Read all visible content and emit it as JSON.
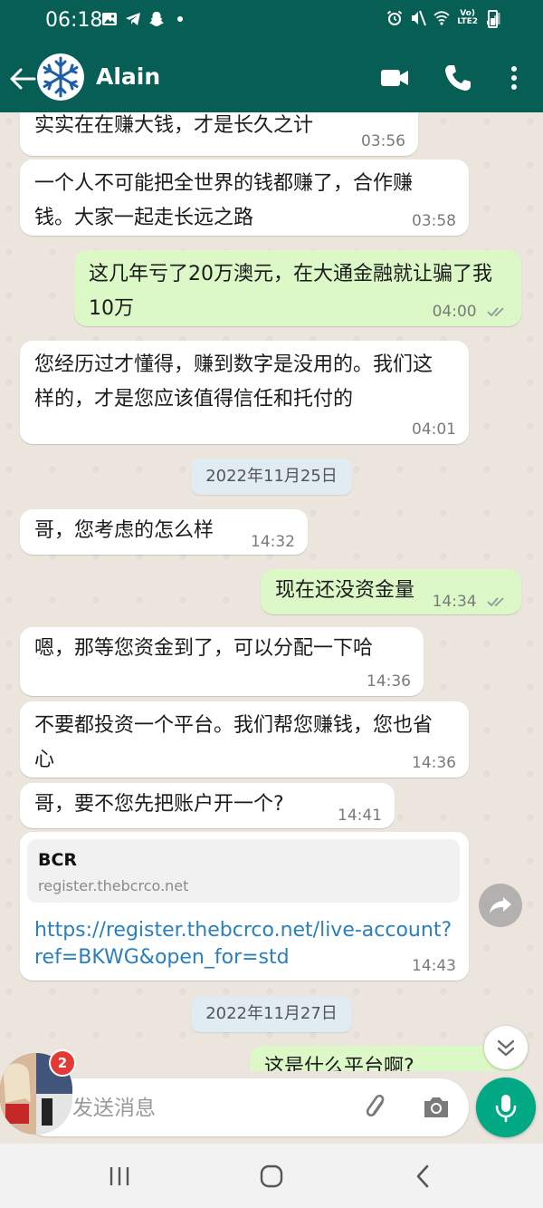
{
  "status_bar": {
    "time": "06:18",
    "network_label": "Vo)\nLTE2"
  },
  "header": {
    "contact_name": "Alain"
  },
  "messages": [
    {
      "dir": "in",
      "text": "实实在在赚大钱，才是长久之计",
      "time": "03:56"
    },
    {
      "dir": "in",
      "text": "一个人不可能把全世界的钱都赚了，合作赚钱。大家一起走长远之路",
      "time": "03:58"
    },
    {
      "dir": "out",
      "text": "这几年亏了20万澳元，在大通金融就让骗了我10万",
      "time": "04:00"
    },
    {
      "dir": "in",
      "text": "您经历过才懂得，赚到数字是没用的。我们这样的，才是您应该值得信任和托付的",
      "time": "04:01"
    },
    {
      "dir": "date",
      "text": "2022年11月25日"
    },
    {
      "dir": "in",
      "text": "哥，您考虑的怎么样",
      "time": "14:32"
    },
    {
      "dir": "out",
      "text": "现在还没资金量",
      "time": "14:34"
    },
    {
      "dir": "in",
      "text": "嗯，那等您资金到了，可以分配一下哈",
      "time": "14:36"
    },
    {
      "dir": "in",
      "text": "不要都投资一个平台。我们帮您赚钱，您也省心",
      "time": "14:36"
    },
    {
      "dir": "in",
      "text": "哥，要不您先把账户开一个?",
      "time": "14:41"
    },
    {
      "dir": "link",
      "preview_title": "BCR",
      "preview_domain": "register.thebcrco.net",
      "text": "https://register.thebcrco.net/live-account?ref=BKWG&open_for=std",
      "time": "14:43"
    },
    {
      "dir": "date",
      "text": "2022年11月27日"
    },
    {
      "dir": "out",
      "text": "这是什么平台啊?",
      "time": ""
    }
  ],
  "composer": {
    "placeholder": "发送消息"
  },
  "chat_head": {
    "badge_count": "2"
  },
  "colors": {
    "header_bg": "#075e54",
    "incoming_bubble": "#ffffff",
    "outgoing_bubble": "#dcf8c6",
    "accent": "#00a884",
    "link": "#2a7fbe"
  }
}
